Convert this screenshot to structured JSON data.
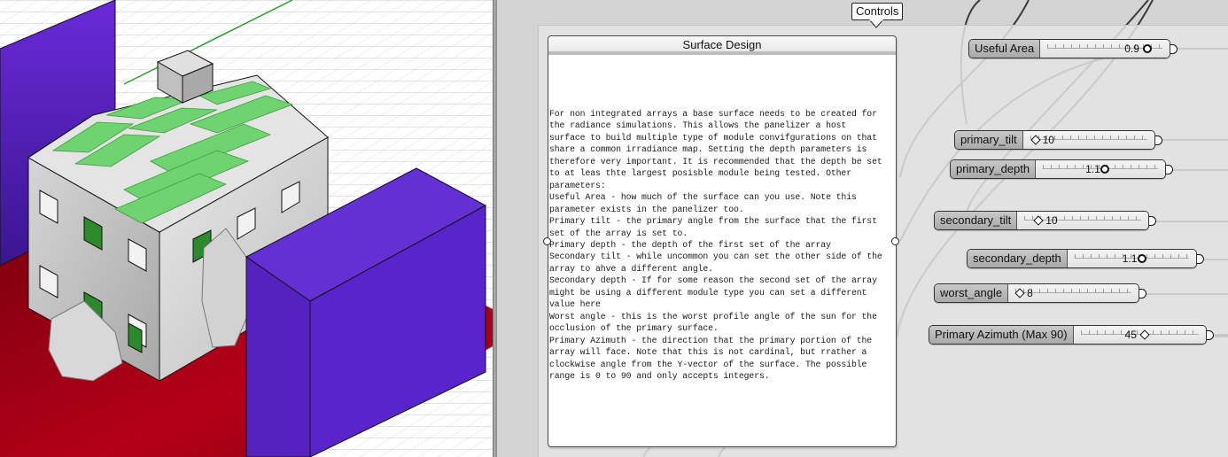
{
  "canvas": {
    "group_label": "Controls"
  },
  "panel": {
    "title": "Surface Design",
    "lines": [
      "For non integrated arrays a base surface needs to be created for",
      "the radiance simulations. This allows the panelizer a host",
      "surface to build multiple type of module convifgurations on that",
      "share a common irradiance map. Setting the depth parameters is",
      "therefore very important. It is recommended that the depth be set",
      "to at leas thte largest posisble module being tested. Other",
      "parameters:",
      "Useful Area - how much of the surface can you use. Note this",
      "parameter exists in the panelizer too.",
      "Primary tilt - the primary angle from the surface that the first",
      "set of the array is set to.",
      "Primary depth - the depth of the first set of the array",
      "Secondary tilt - while uncommon you can set the other side of the",
      "array to ahve a different angle.",
      "Secondary depth - If for some reason the second set of the array",
      "might be using a different module type you can set a different",
      "value here",
      "Worst angle - this is the worst profile angle of the sun for the",
      "occlusion of the primary surface.",
      "Primary Azimuth - the direction that the primary portion of the",
      "array will face. Note that this is not cardinal, but rrather a",
      "clockwise angle from the Y-vector of the surface. The possible",
      "range is 0 to 90 and only accepts integers."
    ]
  },
  "sliders": [
    {
      "id": "useful-area",
      "label": "Useful Area",
      "value": "0.9",
      "knob": "round",
      "position": 0.9
    },
    {
      "id": "primary-tilt",
      "label": "primary_tilt",
      "value": "10",
      "knob": "diamond",
      "position": 0.1
    },
    {
      "id": "primary-depth",
      "label": "primary_depth",
      "value": "1.1",
      "knob": "round",
      "position": 0.55
    },
    {
      "id": "secondary-tilt",
      "label": "secondary_tilt",
      "value": "10",
      "knob": "diamond",
      "position": 0.1
    },
    {
      "id": "secondary-depth",
      "label": "secondary_depth",
      "value": "1.1",
      "knob": "round",
      "position": 0.55
    },
    {
      "id": "worst-angle",
      "label": "worst_angle",
      "value": "8",
      "knob": "diamond",
      "position": 0.08
    },
    {
      "id": "primary-azimuth",
      "label": "Primary Azimuth (Max 90)",
      "value": "45",
      "knob": "diamond",
      "position": 0.5
    }
  ],
  "colors": {
    "building_purple": "#5a22c8",
    "ground_red": "#a00010",
    "roof_green": "#6fd46f",
    "wall_grey": "#cfcfcf"
  }
}
